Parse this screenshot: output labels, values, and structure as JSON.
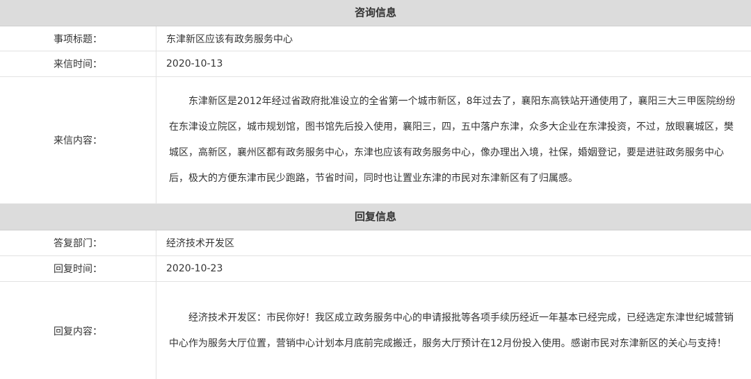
{
  "inquiry": {
    "section_title": "咨询信息",
    "subject_label": "事项标题：",
    "subject_value": "东津新区应该有政务服务中心",
    "date_label": "来信时间：",
    "date_value": "2020-10-13",
    "content_label": "来信内容：",
    "content_value": "东津新区是2012年经过省政府批准设立的全省第一个城市新区，8年过去了，襄阳东高铁站开通使用了，襄阳三大三甲医院纷纷在东津设立院区，城市规划馆，图书馆先后投入使用，襄阳三，四，五中落户东津，众多大企业在东津投资，不过，放眼襄城区，樊城区，高新区，襄州区都有政务服务中心，东津也应该有政务服务中心，像办理出入境，社保，婚姻登记，要是进驻政务服务中心后，极大的方便东津市民少跑路，节省时间，同时也让置业东津的市民对东津新区有了归属感。"
  },
  "reply": {
    "section_title": "回复信息",
    "dept_label": "答复部门：",
    "dept_value": "经济技术开发区",
    "date_label": "回复时间：",
    "date_value": "2020-10-23",
    "content_label": "回复内容：",
    "content_value": "经济技术开发区：市民你好！我区成立政务服务中心的申请报批等各项手续历经近一年基本已经完成，已经选定东津世纪城营销中心作为服务大厅位置，营销中心计划本月底前完成搬迁，服务大厅预计在12月份投入使用。感谢市民对东津新区的关心与支持！"
  }
}
